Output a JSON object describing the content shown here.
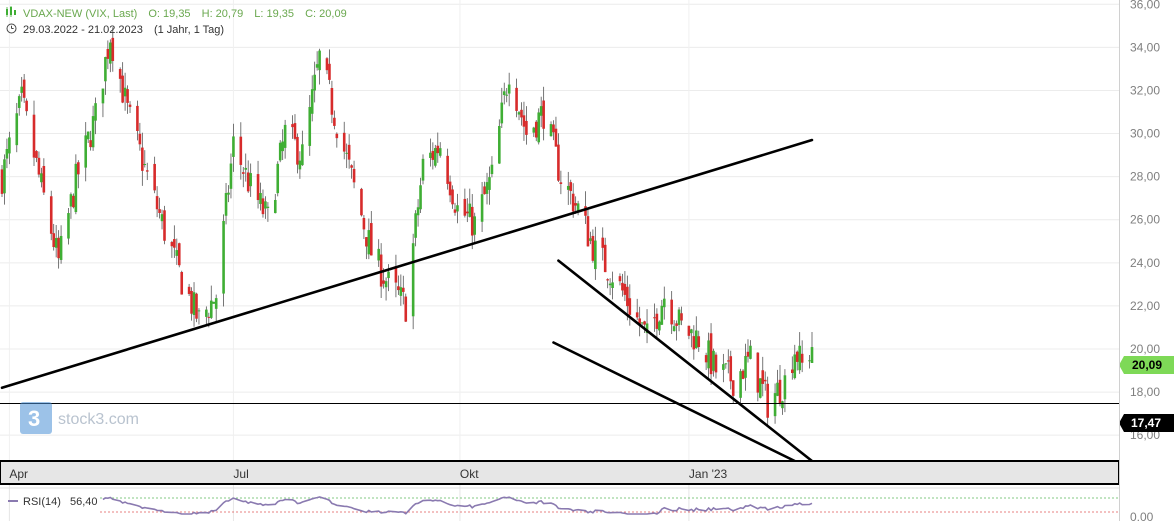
{
  "header": {
    "instrument": "VDAX-NEW (VIX, Last)",
    "open_label": "O: 19,35",
    "high_label": "H: 20,79",
    "low_label": "L: 19,35",
    "close_label": "C: 20,09",
    "range": "29.03.2022 - 21.02.2023",
    "period": "(1 Jahr, 1 Tag)"
  },
  "watermark": "stock3.com",
  "colors": {
    "up": "#3fae34",
    "down": "#d72b2b",
    "last_price_badge": "#7ed957",
    "ref_badge": "#000000",
    "trendline": "#000000",
    "rsi_line": "#8a7ab0",
    "rsi_upper": "#5bb85b",
    "rsi_lower": "#e05a5a"
  },
  "badges": {
    "last_price": "20,09",
    "reference_line": "17,47"
  },
  "chart_data": [
    {
      "type": "candlestick",
      "title": "VDAX-NEW (VIX, Last)",
      "y_axis_side": "right",
      "ylim": [
        14.8,
        36.2
      ],
      "y_ticks": [
        "36,00",
        "34,00",
        "32,00",
        "30,00",
        "28,00",
        "26,00",
        "24,00",
        "22,00",
        "20,00",
        "18,00",
        "16,00"
      ],
      "y_tick_values": [
        36,
        34,
        32,
        30,
        28,
        26,
        24,
        22,
        20,
        18,
        16
      ],
      "x_range": [
        "2022-03-29",
        "2023-02-21"
      ],
      "x_ticks": [
        {
          "label": "Apr",
          "date": "2022-04-01"
        },
        {
          "label": "Jul",
          "date": "2022-07-01"
        },
        {
          "label": "Okt",
          "date": "2022-10-01"
        },
        {
          "label": "Jan '23",
          "date": "2023-01-02"
        }
      ],
      "last": {
        "open": 19.35,
        "high": 20.79,
        "low": 19.35,
        "close": 20.09
      },
      "horizontal_line": 17.47,
      "trendlines": [
        {
          "from": [
            "2022-03-29",
            18.2
          ],
          "to": [
            "2023-02-21",
            29.7
          ]
        },
        {
          "from": [
            "2022-11-10",
            24.1
          ],
          "to": [
            "2023-02-21",
            14.8
          ]
        },
        {
          "from": [
            "2022-11-08",
            20.3
          ],
          "to": [
            "2023-02-14",
            14.8
          ]
        }
      ],
      "anchors": [
        {
          "date": "2022-03-29",
          "value": 28.0
        },
        {
          "date": "2022-04-06",
          "value": 31.5
        },
        {
          "date": "2022-04-14",
          "value": 27.5
        },
        {
          "date": "2022-04-21",
          "value": 24.0
        },
        {
          "date": "2022-04-28",
          "value": 27.8
        },
        {
          "date": "2022-05-06",
          "value": 30.8
        },
        {
          "date": "2022-05-12",
          "value": 34.6
        },
        {
          "date": "2022-05-19",
          "value": 31.0
        },
        {
          "date": "2022-05-27",
          "value": 28.0
        },
        {
          "date": "2022-06-03",
          "value": 25.5
        },
        {
          "date": "2022-06-10",
          "value": 23.2
        },
        {
          "date": "2022-06-17",
          "value": 21.3
        },
        {
          "date": "2022-06-24",
          "value": 22.5
        },
        {
          "date": "2022-07-01",
          "value": 29.5
        },
        {
          "date": "2022-07-08",
          "value": 27.5
        },
        {
          "date": "2022-07-15",
          "value": 26.0
        },
        {
          "date": "2022-07-22",
          "value": 30.0
        },
        {
          "date": "2022-07-29",
          "value": 29.0
        },
        {
          "date": "2022-08-05",
          "value": 33.5
        },
        {
          "date": "2022-08-12",
          "value": 30.5
        },
        {
          "date": "2022-08-19",
          "value": 27.5
        },
        {
          "date": "2022-08-26",
          "value": 24.5
        },
        {
          "date": "2022-09-02",
          "value": 23.0
        },
        {
          "date": "2022-09-09",
          "value": 22.0
        },
        {
          "date": "2022-09-16",
          "value": 28.5
        },
        {
          "date": "2022-09-23",
          "value": 29.5
        },
        {
          "date": "2022-09-30",
          "value": 26.5
        },
        {
          "date": "2022-10-07",
          "value": 25.8
        },
        {
          "date": "2022-10-14",
          "value": 28.0
        },
        {
          "date": "2022-10-21",
          "value": 33.0
        },
        {
          "date": "2022-10-28",
          "value": 30.0
        },
        {
          "date": "2022-11-04",
          "value": 31.0
        },
        {
          "date": "2022-11-11",
          "value": 28.0
        },
        {
          "date": "2022-11-18",
          "value": 26.5
        },
        {
          "date": "2022-11-25",
          "value": 24.5
        },
        {
          "date": "2022-12-02",
          "value": 23.5
        },
        {
          "date": "2022-12-09",
          "value": 22.0
        },
        {
          "date": "2022-12-16",
          "value": 20.5
        },
        {
          "date": "2022-12-23",
          "value": 22.5
        },
        {
          "date": "2022-12-30",
          "value": 21.0
        },
        {
          "date": "2023-01-06",
          "value": 20.5
        },
        {
          "date": "2023-01-13",
          "value": 19.0
        },
        {
          "date": "2023-01-20",
          "value": 18.6
        },
        {
          "date": "2023-01-27",
          "value": 19.5
        },
        {
          "date": "2023-02-03",
          "value": 17.5
        },
        {
          "date": "2023-02-10",
          "value": 18.5
        },
        {
          "date": "2023-02-14",
          "value": 20.0
        },
        {
          "date": "2023-02-17",
          "value": 19.2
        },
        {
          "date": "2023-02-21",
          "value": 20.09
        }
      ]
    },
    {
      "type": "line",
      "title": "RSI(14)",
      "value_label": "56,40",
      "y_ticks": [
        "0,00"
      ],
      "reference_levels": [
        "upper",
        "lower"
      ]
    }
  ]
}
